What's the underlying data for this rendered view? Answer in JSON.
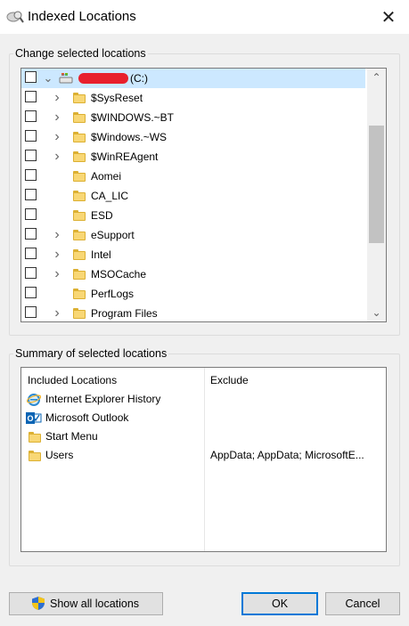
{
  "window": {
    "title": "Indexed Locations",
    "close_symbol": "✕"
  },
  "locations": {
    "legend": "Change selected locations",
    "root": {
      "label": "(C:)",
      "expander": "⌄"
    },
    "items": [
      {
        "label": "$SysReset",
        "expandable": true
      },
      {
        "label": "$WINDOWS.~BT",
        "expandable": true
      },
      {
        "label": "$Windows.~WS",
        "expandable": true
      },
      {
        "label": "$WinREAgent",
        "expandable": true
      },
      {
        "label": "Aomei",
        "expandable": false
      },
      {
        "label": "CA_LIC",
        "expandable": false
      },
      {
        "label": "ESD",
        "expandable": false
      },
      {
        "label": "eSupport",
        "expandable": true
      },
      {
        "label": "Intel",
        "expandable": true
      },
      {
        "label": "MSOCache",
        "expandable": true
      },
      {
        "label": "PerfLogs",
        "expandable": false
      },
      {
        "label": "Program Files",
        "expandable": true
      }
    ],
    "scroll_up": "⌃",
    "scroll_down": "⌄"
  },
  "summary": {
    "legend": "Summary of selected locations",
    "col_included": "Included Locations",
    "col_exclude": "Exclude",
    "rows": [
      {
        "icon": "internet-explorer-icon",
        "label": "Internet Explorer History",
        "exclude": ""
      },
      {
        "icon": "outlook-icon",
        "label": "Microsoft Outlook",
        "exclude": "",
        "badge": "O"
      },
      {
        "icon": "folder-icon",
        "label": "Start Menu",
        "exclude": ""
      },
      {
        "icon": "folder-icon",
        "label": "Users",
        "exclude": "AppData; AppData; MicrosoftE..."
      }
    ]
  },
  "buttons": {
    "show_all": "Show all locations",
    "ok": "OK",
    "cancel": "Cancel"
  },
  "colors": {
    "accent": "#0078d7",
    "selection": "#cce8ff",
    "redaction": "#e8202d",
    "folder": "#f8d775"
  }
}
